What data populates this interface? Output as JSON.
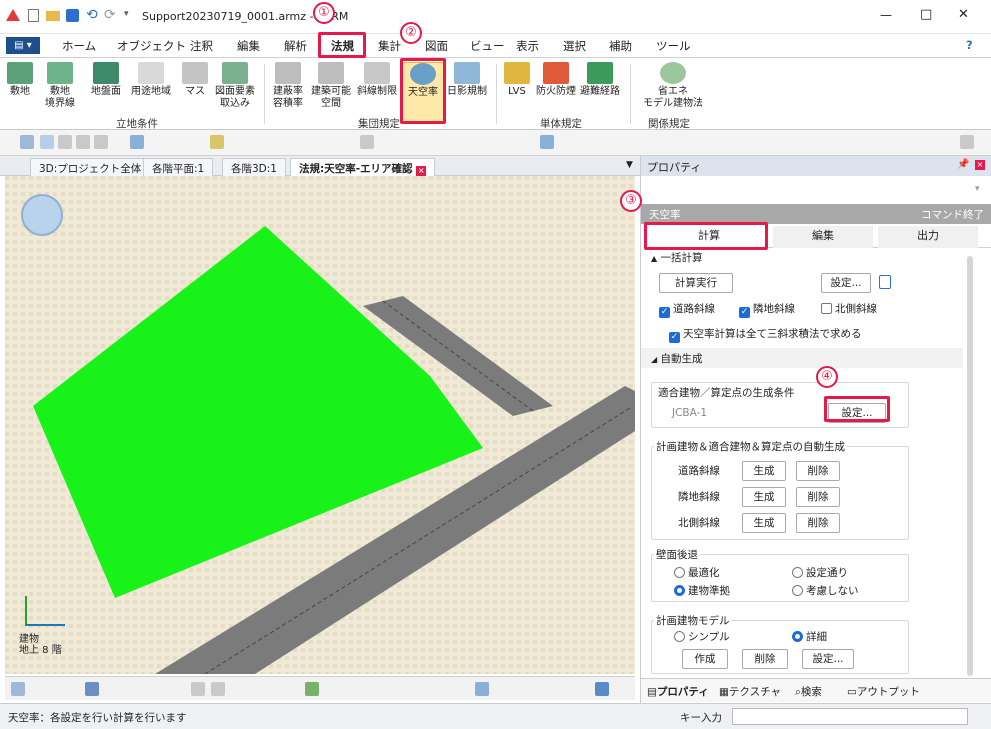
{
  "window": {
    "title": "Support20230719_0001.armz - i-ARM",
    "controls": [
      "—",
      "□",
      "✕"
    ]
  },
  "menu": {
    "items": [
      "ホーム",
      "オブジェクト",
      "注釈",
      "編集",
      "解析",
      "法規",
      "集計",
      "図面",
      "ビュー",
      "表示",
      "選択",
      "補助",
      "ツール"
    ],
    "help": "?"
  },
  "ribbon": {
    "buttons": [
      "敷地",
      "敷地\n境界線",
      "地盤面",
      "用途地域",
      "マス",
      "図面要素\n取込み",
      "建蔽率\n容積率",
      "建築可能\n空間",
      "斜線制限",
      "天空率",
      "日影規制",
      "LVS",
      "防火防煙",
      "避難経路",
      "省エネ\nモデル建物法"
    ],
    "groups": [
      "立地条件",
      "集団規定",
      "単体規定",
      "関係規定"
    ]
  },
  "doc_tabs": [
    "3D:プロジェクト全体",
    "各階平面:1",
    "各階3D:1",
    "法規:天空率-エリア確認"
  ],
  "viewport": {
    "axis_label": "建物\n地上 8 階"
  },
  "panel": {
    "title": "プロパティ",
    "section_title": "天空率",
    "command_end": "コマンド終了",
    "tabs": [
      "計算",
      "編集",
      "出力"
    ],
    "batch_calc": "一括計算",
    "run_button": "計算実行",
    "settings_button": "設定...",
    "checks": [
      {
        "label": "道路斜線",
        "checked": true
      },
      {
        "label": "隣地斜線",
        "checked": true
      },
      {
        "label": "北側斜線",
        "checked": false
      }
    ],
    "precise_check": "天空率計算は全て三斜求積法で求める",
    "auto_gen": "自動生成",
    "cond_title": "適合建物／算定点の生成条件",
    "cond_value": "JCBA-1",
    "cond_settings": "設定...",
    "autogen_title": "計画建物＆適合建物＆算定点の自動生成",
    "rows": [
      {
        "label": "道路斜線",
        "gen": "生成",
        "del": "削除"
      },
      {
        "label": "隣地斜線",
        "gen": "生成",
        "del": "削除"
      },
      {
        "label": "北側斜線",
        "gen": "生成",
        "del": "削除"
      }
    ],
    "setback_title": "壁面後退",
    "setback_options": [
      {
        "label": "最適化",
        "on": false
      },
      {
        "label": "設定通り",
        "on": false
      },
      {
        "label": "建物準拠",
        "on": true
      },
      {
        "label": "考慮しない",
        "on": false
      }
    ],
    "model_title": "計画建物モデル",
    "model_options": [
      {
        "label": "シンプル",
        "on": false
      },
      {
        "label": "詳細",
        "on": true
      }
    ],
    "model_buttons": [
      "作成",
      "削除",
      "設定..."
    ],
    "bottom_tabs": [
      "プロパティ",
      "テクスチャ",
      "検索",
      "アウトプット"
    ]
  },
  "status": {
    "text": "天空率：各設定を行い計算を行います",
    "key_input": "キー入力"
  },
  "markers": [
    "①",
    "②",
    "③",
    "④"
  ]
}
